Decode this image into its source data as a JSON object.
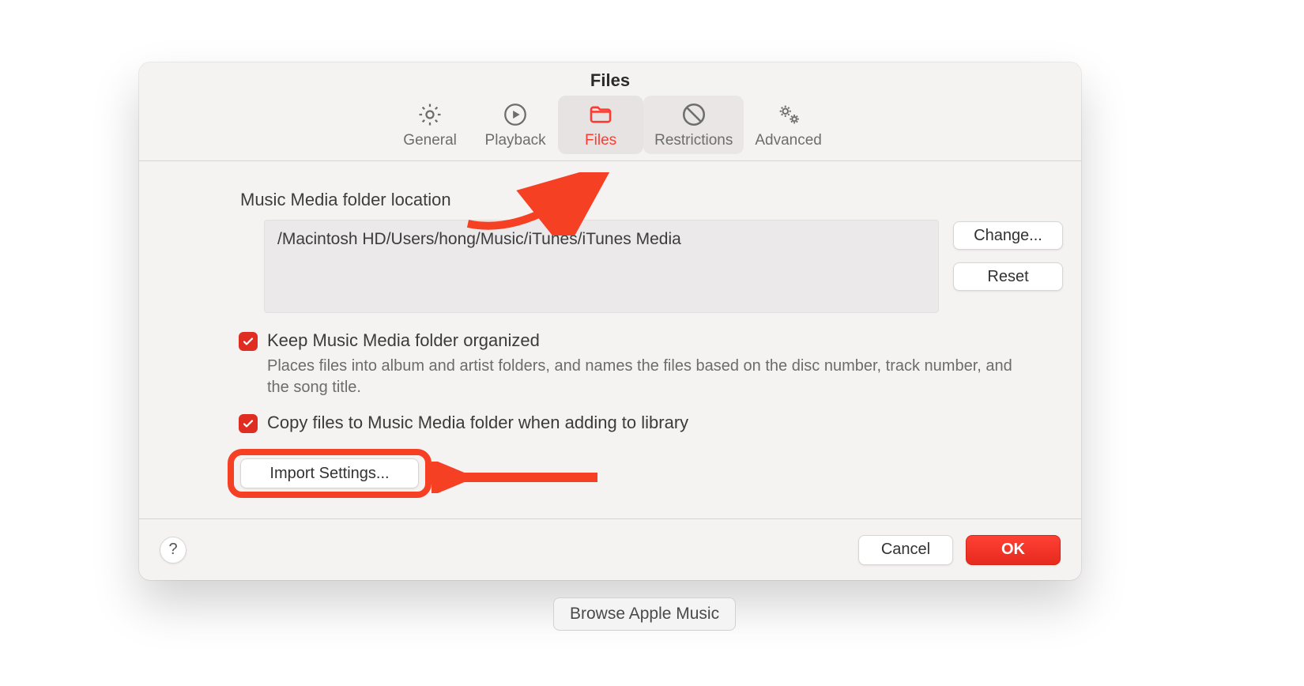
{
  "title": "Files",
  "tabs": {
    "general": "General",
    "playback": "Playback",
    "files": "Files",
    "restrictions": "Restrictions",
    "advanced": "Advanced"
  },
  "section": {
    "media_folder_label": "Music Media folder location",
    "media_folder_path": "/Macintosh HD/Users/hong/Music/iTunes/iTunes Media",
    "change_btn": "Change...",
    "reset_btn": "Reset",
    "keep_organized_label": "Keep Music Media folder organized",
    "keep_organized_help": "Places files into album and artist folders, and names the files based on the disc number, track number, and the song title.",
    "copy_files_label": "Copy files to Music Media folder when adding to library",
    "import_settings_btn": "Import Settings..."
  },
  "footer": {
    "help": "?",
    "cancel": "Cancel",
    "ok": "OK"
  },
  "browse_button": "Browse Apple Music"
}
